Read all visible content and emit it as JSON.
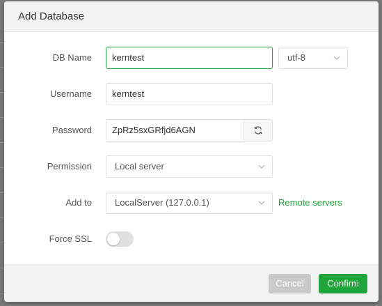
{
  "dialog": {
    "title": "Add Database"
  },
  "form": {
    "db_name": {
      "label": "DB Name",
      "value": "kerntest"
    },
    "charset": {
      "value": "utf-8"
    },
    "username": {
      "label": "Username",
      "value": "kerntest"
    },
    "password": {
      "label": "Password",
      "value": "ZpRz5sxGRfjd6AGN"
    },
    "permission": {
      "label": "Permission",
      "value": "Local server"
    },
    "add_to": {
      "label": "Add to",
      "value": "LocalServer (127.0.0.1)",
      "link": "Remote servers"
    },
    "force_ssl": {
      "label": "Force SSL",
      "enabled": false
    }
  },
  "footer": {
    "cancel_label": "Cancel",
    "confirm_label": "Confirm"
  },
  "colors": {
    "accent": "#20a53a",
    "disabled_button": "#c9c9c9",
    "header_bg": "#f3f3f3"
  },
  "icons": {
    "charset_caret": "chevron-down-icon",
    "refresh": "refresh-icon",
    "permission_caret": "chevron-down-icon",
    "add_to_caret": "chevron-down-icon"
  }
}
